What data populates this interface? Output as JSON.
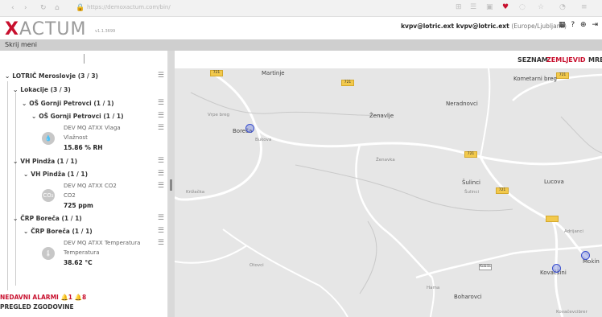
{
  "browser": {
    "url": "https://demoxactum.com/bin/"
  },
  "header": {
    "logo": "ACTUM",
    "logo_x": "X",
    "version": "v1.1.3699",
    "user": "kvpv@lotric.ext kvpv@lotric.ext",
    "timezone": "(Europe/Ljubljana)"
  },
  "hide_menu": "Skrij meni",
  "tree": {
    "root": "LOTRIČ Meroslovje (3 / 3)",
    "locations": "Lokacije (3 / 3)",
    "groups": [
      {
        "name": "OŠ Gornji Petrovci (1 / 1)",
        "sub": "OŠ Gornji Petrovci (1 / 1)",
        "sensor": "DEV MQ ATXX Vlaga",
        "type": "Vlažnost",
        "value": "15.86 % RH",
        "icon": "humidity-icon",
        "glyph": "💧"
      },
      {
        "name": "VH Pindža (1 / 1)",
        "sub": "VH Pindža (1 / 1)",
        "sensor": "DEV MQ ATXX CO2",
        "type": "CO2",
        "value": "725 ppm",
        "icon": "co2-icon",
        "glyph": "CO₂"
      },
      {
        "name": "ČRP Boreča (1 / 1)",
        "sub": "ČRP Boreča (1 / 1)",
        "sensor": "DEV MQ ATXX Temperatura",
        "type": "Temperatura",
        "value": "38.62 °C",
        "icon": "thermometer-icon",
        "glyph": "🌡"
      }
    ]
  },
  "footer": {
    "alarms_label": "NEDAVNI ALARMI",
    "alarms_red": "1",
    "alarms_black": "8",
    "history": "PREGLED ZGODOVINE"
  },
  "map_nav": {
    "list": "SEZNAM",
    "map": "ZEMLJEVID",
    "net": "MRE"
  },
  "map": {
    "places": {
      "martinje": "Martinje",
      "kometarni_breg": "Kometarni breg",
      "neradnovci": "Neradnovci",
      "zenavlje": "Ženavlje",
      "boreca": "Boreča",
      "sulinci": "Šulinci",
      "lucova": "Lucova",
      "krizacka": "Križačka",
      "kovacsini": "Kovačšini",
      "mokin": "Mokin",
      "boharovci": "Boharovci",
      "vrpe_breg": "Vrpe breg",
      "zenavka": "Ženavka",
      "sulinci_small": "Šulinci",
      "bukova": "Bukova",
      "otovci": "Otovci",
      "hama": "Hama",
      "adrijanci": "Adrijanci",
      "bottom_right": "Kovačevcibrer"
    },
    "roads": {
      "r1": "721",
      "r2": "721",
      "r3": "721",
      "r4": "721",
      "r5": "721",
      "r6": "Kobila"
    }
  }
}
